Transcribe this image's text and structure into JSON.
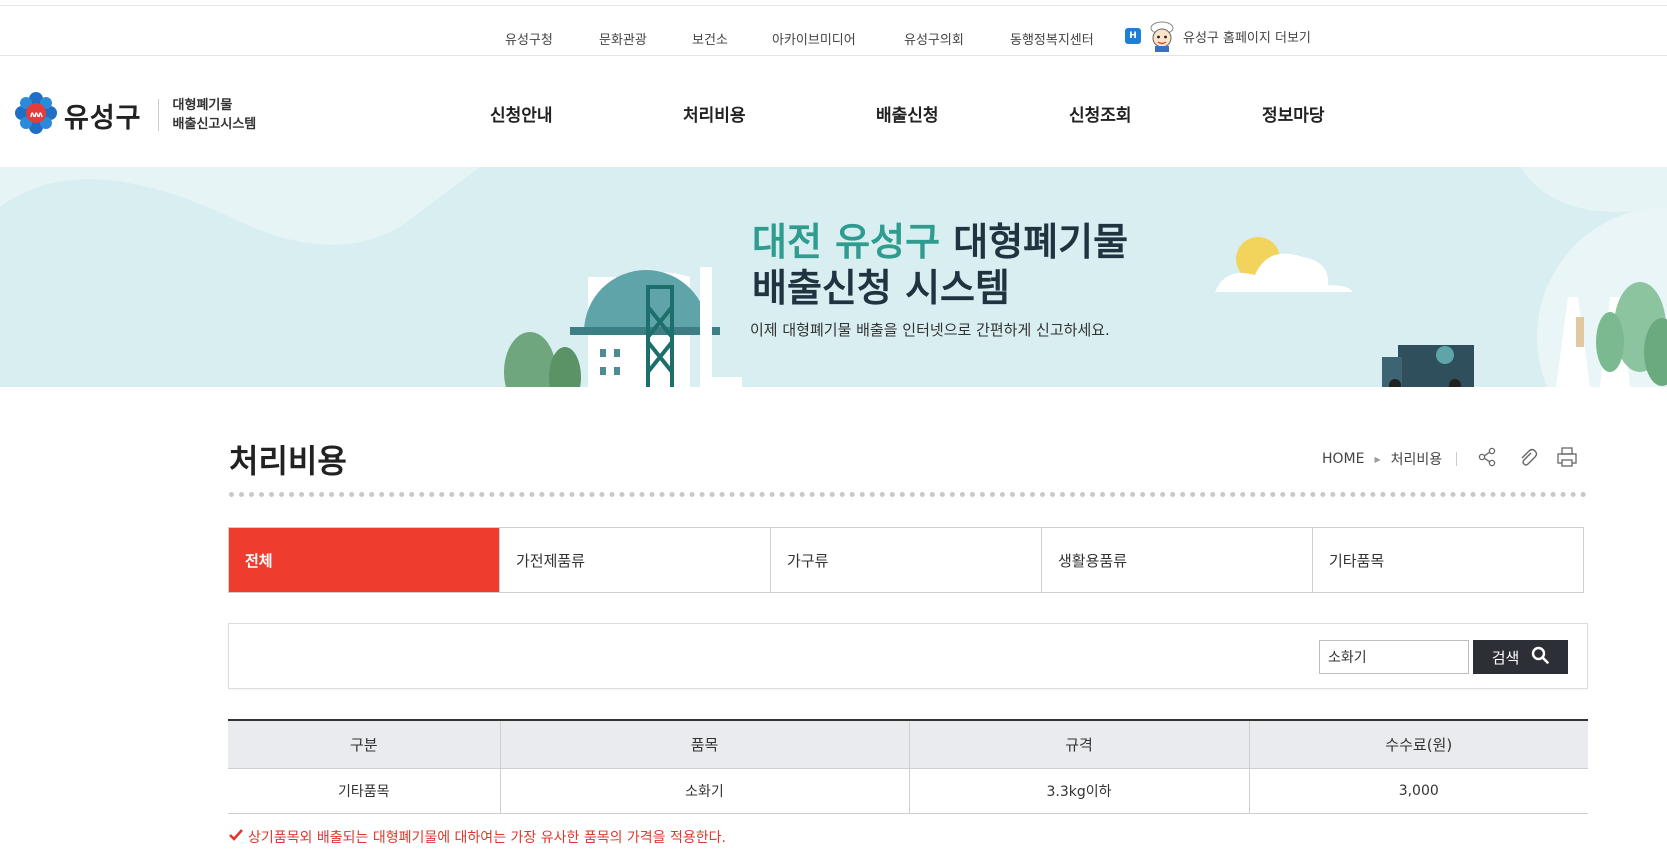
{
  "util_links": [
    "유성구청",
    "문화관광",
    "보건소",
    "아카이브미디어",
    "유성구의회",
    "동행정복지센터"
  ],
  "util_more": {
    "badge": "H",
    "label": "유성구 홈페이지 더보기"
  },
  "logo": {
    "name": "유성구",
    "sub_line1": "대형폐기물",
    "sub_line2": "배출신고시스템"
  },
  "gnb": [
    "신청안내",
    "처리비용",
    "배출신청",
    "신청조회",
    "정보마당"
  ],
  "banner": {
    "title_accent": "대전 유성구",
    "title_rest": " 대형폐기물",
    "title_line2": "배출신청 시스템",
    "desc": "이제 대형폐기물 배출을 인터넷으로 간편하게 신고하세요."
  },
  "page_title": "처리비용",
  "breadcrumb": {
    "home": "HOME",
    "current": "처리비용"
  },
  "tabs": [
    {
      "label": "전체",
      "active": true
    },
    {
      "label": "가전제품류",
      "active": false
    },
    {
      "label": "가구류",
      "active": false
    },
    {
      "label": "생활용품류",
      "active": false
    },
    {
      "label": "기타품목",
      "active": false
    }
  ],
  "search": {
    "value": "소화기",
    "button_label": "검색"
  },
  "table": {
    "headers": [
      "구분",
      "품목",
      "규격",
      "수수료(원)"
    ],
    "rows": [
      [
        "기타품목",
        "소화기",
        "3.3kg이하",
        "3,000"
      ]
    ]
  },
  "note": "상기품목외 배출되는 대형폐기물에 대하여는 가장 유사한 품목의 가격을 적용한다.",
  "colors": {
    "accent_red": "#ee3d2f",
    "banner_bg": "#d9eef1",
    "teal": "#2e9c8f",
    "dark_button": "#2c2f36"
  }
}
